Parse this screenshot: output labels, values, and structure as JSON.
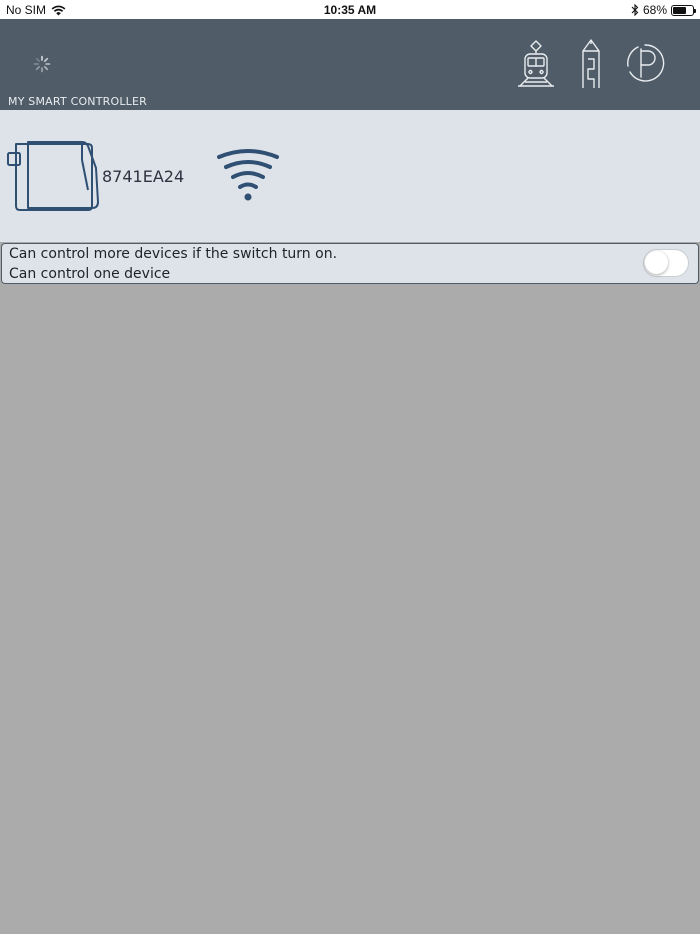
{
  "status_bar": {
    "carrier": "No SIM",
    "time": "10:35 AM",
    "battery_text": "68%",
    "battery_level": 0.68
  },
  "header": {
    "title": "MY SMART CONTROLLER",
    "icons": [
      "tram-icon",
      "tower-icon",
      "parking-icon"
    ],
    "color": "#505c67"
  },
  "device": {
    "id": "8741EA24",
    "icon": "controller-device-icon",
    "signal_icon": "wifi-icon"
  },
  "option": {
    "line1": "Can control more devices if the switch turn on.",
    "line2": "Can control one device",
    "toggle_on": false
  },
  "colors": {
    "accent": "#2f4f73",
    "panel": "#dde3e8",
    "background": "#ababab"
  }
}
